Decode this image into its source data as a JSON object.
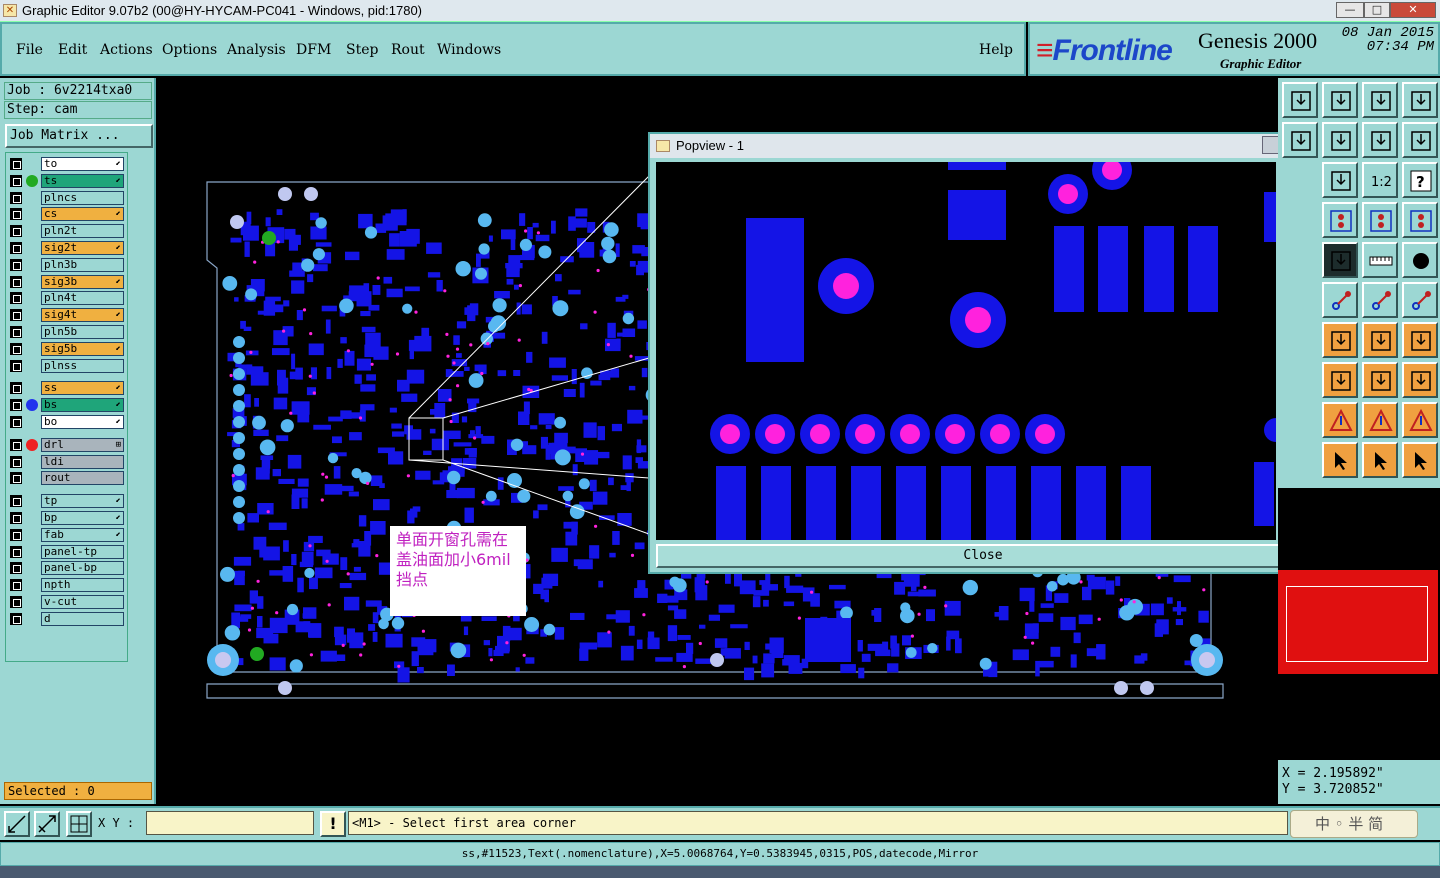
{
  "window": {
    "title": "Graphic Editor 9.07b2 (00@HY-HYCAM-PC041 - Windows, pid:1780)",
    "minimize": "—",
    "maximize": "□",
    "close": "✕"
  },
  "menu": {
    "items": [
      "File",
      "Edit",
      "Actions",
      "Options",
      "Analysis",
      "DFM",
      "Step",
      "Rout",
      "Windows"
    ],
    "help": "Help"
  },
  "brand": {
    "logo_prefix": "≡",
    "logo": "Frontline",
    "product": "Genesis 2000",
    "subtitle": "Graphic Editor",
    "date": "08 Jan 2015",
    "time": "07:34 PM"
  },
  "job": {
    "job_label": "Job  : 6v2214txa0",
    "step_label": "Step: cam",
    "matrix_button": "Job Matrix ..."
  },
  "layers": [
    {
      "name": "to",
      "color": "#ffffff",
      "dot": "",
      "arrow": "⬋"
    },
    {
      "name": "ts",
      "color": "#1fa57a",
      "dot": "#22aa22",
      "arrow": "⬋"
    },
    {
      "name": "plncs",
      "color": "#9cd7d3",
      "dot": "",
      "arrow": ""
    },
    {
      "name": "cs",
      "color": "#f0b040",
      "dot": "",
      "arrow": "⬋"
    },
    {
      "name": "pln2t",
      "color": "#9cd7d3",
      "dot": "",
      "arrow": ""
    },
    {
      "name": "sig2t",
      "color": "#f0b040",
      "dot": "",
      "arrow": "⬋"
    },
    {
      "name": "pln3b",
      "color": "#9cd7d3",
      "dot": "",
      "arrow": ""
    },
    {
      "name": "sig3b",
      "color": "#f0b040",
      "dot": "",
      "arrow": "⬋"
    },
    {
      "name": "pln4t",
      "color": "#9cd7d3",
      "dot": "",
      "arrow": ""
    },
    {
      "name": "sig4t",
      "color": "#f0b040",
      "dot": "",
      "arrow": "⬋"
    },
    {
      "name": "pln5b",
      "color": "#9cd7d3",
      "dot": "",
      "arrow": ""
    },
    {
      "name": "sig5b",
      "color": "#f0b040",
      "dot": "",
      "arrow": "⬋"
    },
    {
      "name": "plnss",
      "color": "#9cd7d3",
      "dot": "",
      "arrow": ""
    },
    {
      "name": "ss",
      "color": "#f0b040",
      "dot": "",
      "arrow": "⬋"
    },
    {
      "name": "bs",
      "color": "#1fa57a",
      "dot": "#2233ee",
      "arrow": "⬋"
    },
    {
      "name": "bo",
      "color": "#ffffff",
      "dot": "",
      "arrow": "⬋"
    },
    {
      "name": "drl",
      "color": "#a9b4bc",
      "dot": "#ee2222",
      "arrow": "⊞"
    },
    {
      "name": "ldi",
      "color": "#a9b4bc",
      "dot": "",
      "arrow": ""
    },
    {
      "name": "rout",
      "color": "#a9b4bc",
      "dot": "",
      "arrow": ""
    },
    {
      "name": "tp",
      "color": "#9cd7d3",
      "dot": "",
      "arrow": "⬋"
    },
    {
      "name": "bp",
      "color": "#9cd7d3",
      "dot": "",
      "arrow": "⬋"
    },
    {
      "name": "fab",
      "color": "#9cd7d3",
      "dot": "",
      "arrow": "⬋"
    },
    {
      "name": "panel-tp",
      "color": "#9cd7d3",
      "dot": "",
      "arrow": ""
    },
    {
      "name": "panel-bp",
      "color": "#9cd7d3",
      "dot": "",
      "arrow": ""
    },
    {
      "name": "npth",
      "color": "#9cd7d3",
      "dot": "",
      "arrow": ""
    },
    {
      "name": "v-cut",
      "color": "#9cd7d3",
      "dot": "",
      "arrow": ""
    },
    {
      "name": "d",
      "color": "#9cd7d3",
      "dot": "",
      "arrow": ""
    }
  ],
  "selected_label": "Selected : 0",
  "note": "单面开窗孔需在盖油面加小6mil挡点",
  "popview": {
    "title": "Popview - 1",
    "close_x": "✕",
    "close_button": "Close"
  },
  "coords": {
    "x": "X  = 2.195892\"",
    "y": "Y  = 3.720852\""
  },
  "cmd": {
    "xy_label": "X Y :",
    "xy_value": "",
    "alert": "!",
    "prompt": "<M1> - Select first area corner",
    "ime": "中 ◦ 半 简"
  },
  "status": "ss,#11523,Text(.nomenclature),X=5.0068764,Y=0.5383945,0315,POS,datecode,Mirror",
  "colors": {
    "panel": "#9cd7d3",
    "pad_blue": "#1414e6",
    "via_light": "#58b8f0",
    "drill_magenta": "#ff22dd",
    "outline": "#8aa6c8"
  }
}
